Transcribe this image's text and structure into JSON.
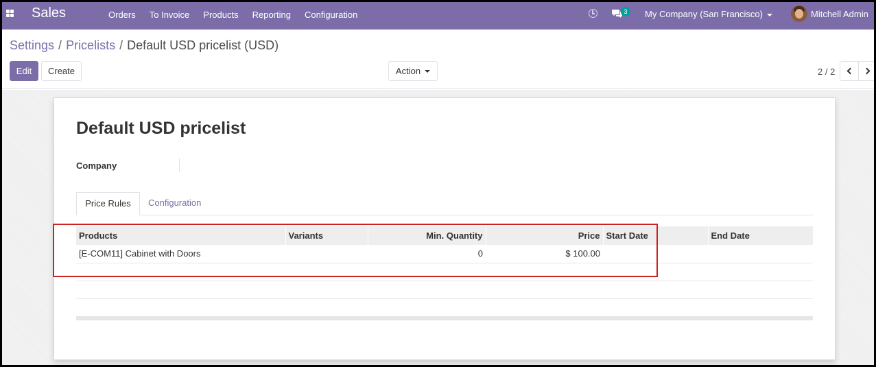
{
  "navbar": {
    "brand": "Sales",
    "menu": [
      "Orders",
      "To Invoice",
      "Products",
      "Reporting",
      "Configuration"
    ],
    "chat_count": "3",
    "company": "My Company (San Francisco)",
    "user": "Mitchell Admin"
  },
  "breadcrumb": {
    "items": [
      "Settings",
      "Pricelists"
    ],
    "current": "Default USD pricelist (USD)"
  },
  "buttons": {
    "edit": "Edit",
    "create": "Create",
    "action": "Action"
  },
  "pager": {
    "value": "2 / 2"
  },
  "form": {
    "title": "Default USD pricelist",
    "company_label": "Company",
    "company_value": ""
  },
  "tabs": [
    "Price Rules",
    "Configuration"
  ],
  "table": {
    "headers": [
      "Products",
      "Variants",
      "Min. Quantity",
      "Price",
      "Start Date",
      "End Date"
    ],
    "rows": [
      {
        "product": "[E-COM11] Cabinet with Doors",
        "variant": "",
        "min_qty": "0",
        "price": "$ 100.00",
        "start_date": "",
        "end_date": ""
      }
    ]
  },
  "colors": {
    "brand": "#7c6da9",
    "badge": "#00a09d",
    "highlight": "#cc2222"
  }
}
